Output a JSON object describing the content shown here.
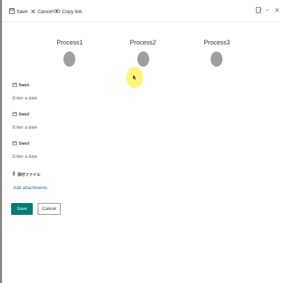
{
  "toolbar": {
    "save_label": "Save",
    "cancel_label": "Cancel",
    "copy_link_label": "Copy link"
  },
  "processes": [
    {
      "label": "Process1"
    },
    {
      "label": "Process2"
    },
    {
      "label": "Process3"
    }
  ],
  "fields": [
    {
      "label": "Date1",
      "placeholder": "Enter a date"
    },
    {
      "label": "Date2",
      "placeholder": "Enter a date"
    },
    {
      "label": "Date3",
      "placeholder": "Enter a date"
    }
  ],
  "attachments": {
    "label": "添付ファイル",
    "add_label": "Add attachments"
  },
  "actions": {
    "save_label": "Save",
    "cancel_label": "Cancel"
  },
  "colors": {
    "accent": "#037c74",
    "link": "#03787c",
    "process_dot": "#a19f9d",
    "cursor_highlight": "#fff46a"
  }
}
